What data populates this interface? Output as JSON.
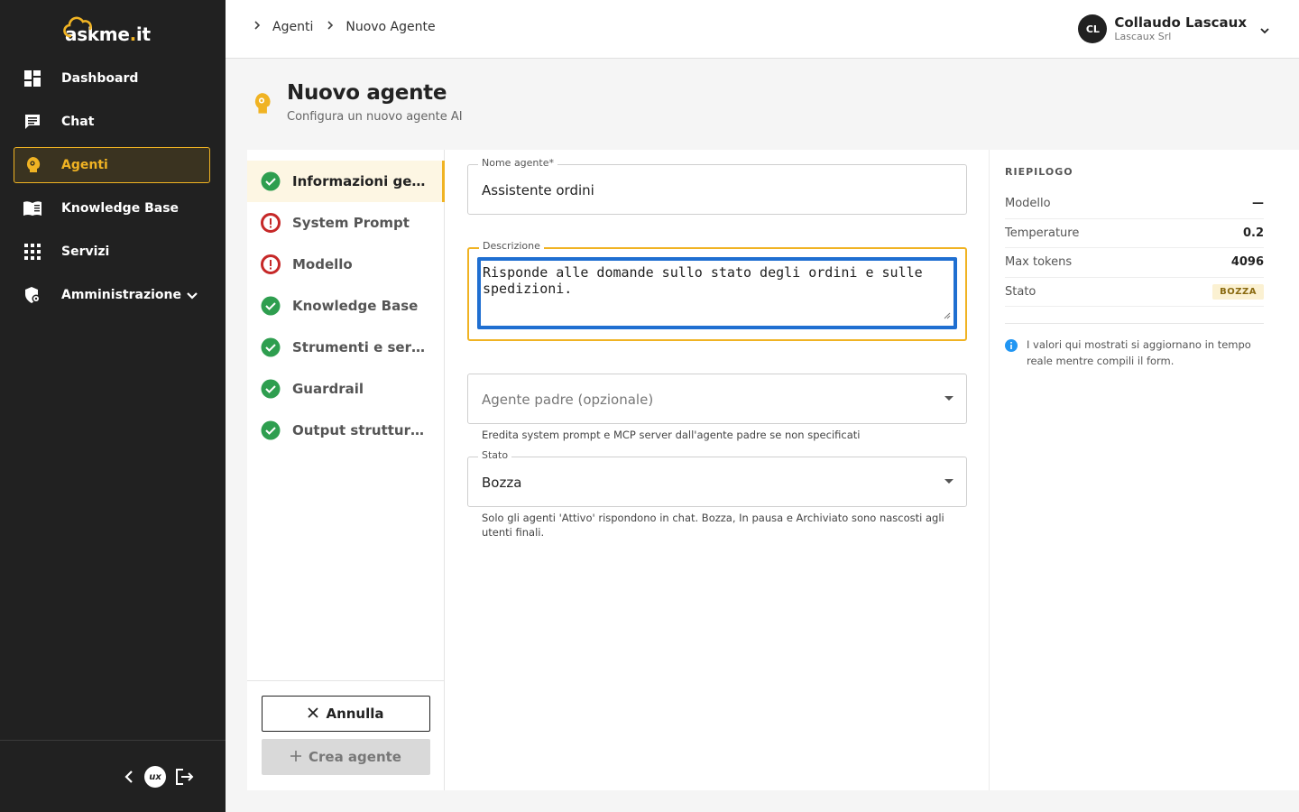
{
  "app": {
    "logo": "askme.it"
  },
  "sidebar": {
    "items": [
      {
        "label": "Dashboard",
        "icon": "dashboard-icon"
      },
      {
        "label": "Chat",
        "icon": "chat-icon"
      },
      {
        "label": "Agenti",
        "icon": "agent-icon",
        "active": true
      },
      {
        "label": "Knowledge Base",
        "icon": "book-icon"
      },
      {
        "label": "Servizi",
        "icon": "grid-icon"
      },
      {
        "label": "Amministrazione",
        "icon": "admin-shield-icon"
      }
    ],
    "footer": {
      "badge": "ux"
    }
  },
  "breadcrumb": {
    "items": [
      "Agenti",
      "Nuovo Agente"
    ]
  },
  "user": {
    "initials": "CL",
    "name": "Collaudo Lascaux",
    "org": "Lascaux Srl"
  },
  "page": {
    "title": "Nuovo agente",
    "subtitle": "Configura un nuovo agente AI"
  },
  "steps": [
    {
      "label": "Informazioni generali",
      "status": "done",
      "active": true
    },
    {
      "label": "System Prompt",
      "status": "error"
    },
    {
      "label": "Modello",
      "status": "error"
    },
    {
      "label": "Knowledge Base",
      "status": "done"
    },
    {
      "label": "Strumenti e servizi",
      "status": "done"
    },
    {
      "label": "Guardrail",
      "status": "done"
    },
    {
      "label": "Output strutturato",
      "status": "done"
    }
  ],
  "actions": {
    "cancel": "Annulla",
    "create": "Crea agente"
  },
  "form": {
    "name": {
      "label": "Nome agente*",
      "value": "Assistente ordini"
    },
    "description": {
      "label": "Descrizione",
      "value": "Risponde alle domande sullo stato degli ordini e sulle spedizioni."
    },
    "parent": {
      "placeholder": "Agente padre (opzionale)",
      "help": "Eredita system prompt e MCP server dall'agente padre se non specificati"
    },
    "state": {
      "label": "Stato",
      "value": "Bozza",
      "help": "Solo gli agenti 'Attivo' rispondono in chat. Bozza, In pausa e Archiviato sono nascosti agli utenti finali."
    }
  },
  "summary": {
    "title": "RIEPILOGO",
    "rows": [
      {
        "key": "Modello",
        "value": "—"
      },
      {
        "key": "Temperature",
        "value": "0.2"
      },
      {
        "key": "Max tokens",
        "value": "4096"
      },
      {
        "key": "Stato",
        "value": "BOZZA"
      }
    ],
    "info": "I valori qui mostrati si aggiornano in tempo reale mentre compili il form."
  },
  "colors": {
    "accent": "#f0b323",
    "sidebar_bg": "#212121",
    "success": "#2e9e4f",
    "error": "#c62828",
    "focus": "#1f6fd1",
    "info": "#2196f3"
  }
}
